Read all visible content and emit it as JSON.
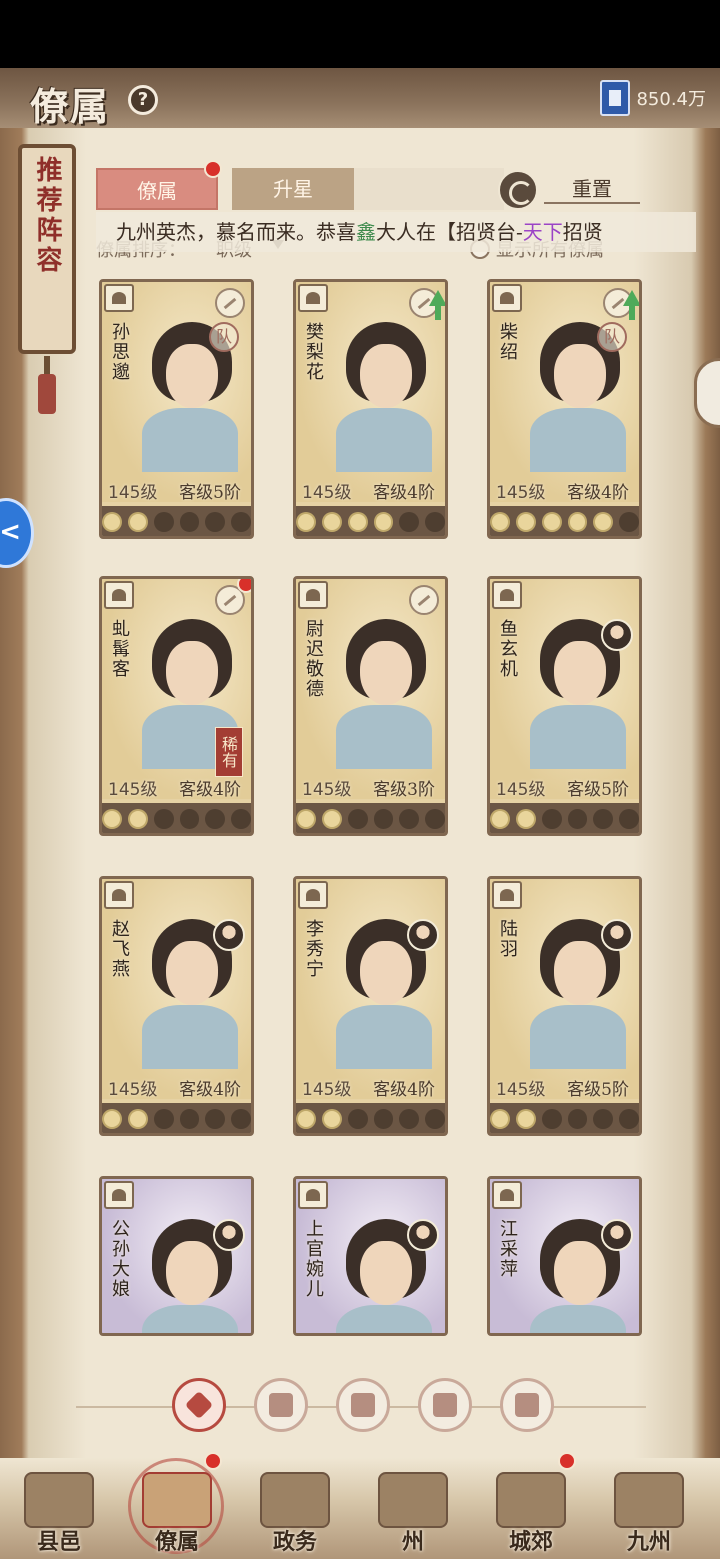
{
  "header": {
    "title": "僚属",
    "currency_value": "850.4万"
  },
  "ribbon": {
    "label": "推荐阵容"
  },
  "tabs": {
    "retainers": "僚属",
    "upgrade": "升星",
    "reset": "重置"
  },
  "marquee": {
    "prefix": "九州英杰，慕名而来。恭喜",
    "player": "鑫",
    "mid": "大人在【招贤台-",
    "pool": "天下",
    "suffix": "招贤"
  },
  "sort": {
    "label": "僚属排序：",
    "value": "职级",
    "show_all": "显示所有僚属"
  },
  "cards": [
    {
      "name": "孙思邈",
      "level": "145级",
      "rank": "客级5阶",
      "stars_on": 2,
      "badge": "队",
      "upgrade": false,
      "rare": "",
      "dot": false,
      "color": "gold"
    },
    {
      "name": "樊梨花",
      "level": "145级",
      "rank": "客级4阶",
      "stars_on": 4,
      "badge": "",
      "upgrade": true,
      "rare": "",
      "dot": false,
      "color": "gold"
    },
    {
      "name": "柴绍",
      "level": "145级",
      "rank": "客级4阶",
      "stars_on": 5,
      "badge": "队",
      "upgrade": true,
      "rare": "",
      "dot": false,
      "color": "gold"
    },
    {
      "name": "虬髯客",
      "level": "145级",
      "rank": "客级4阶",
      "stars_on": 2,
      "badge": "",
      "upgrade": false,
      "rare": "稀有",
      "dot": true,
      "color": "gold"
    },
    {
      "name": "尉迟敬德",
      "level": "145级",
      "rank": "客级3阶",
      "stars_on": 2,
      "badge": "",
      "upgrade": false,
      "rare": "",
      "dot": false,
      "color": "gold"
    },
    {
      "name": "鱼玄机",
      "level": "145级",
      "rank": "客级5阶",
      "stars_on": 2,
      "badge": "avatar",
      "upgrade": false,
      "rare": "",
      "dot": false,
      "color": "gold"
    },
    {
      "name": "赵飞燕",
      "level": "145级",
      "rank": "客级4阶",
      "stars_on": 2,
      "badge": "avatar",
      "upgrade": false,
      "rare": "",
      "dot": false,
      "color": "gold"
    },
    {
      "name": "李秀宁",
      "level": "145级",
      "rank": "客级4阶",
      "stars_on": 2,
      "badge": "avatar",
      "upgrade": false,
      "rare": "",
      "dot": false,
      "color": "gold"
    },
    {
      "name": "陆羽",
      "level": "145级",
      "rank": "客级5阶",
      "stars_on": 2,
      "badge": "avatar",
      "upgrade": false,
      "rare": "",
      "dot": false,
      "color": "gold"
    },
    {
      "name": "公孙大娘",
      "level": "",
      "rank": "",
      "stars_on": 0,
      "badge": "avatar",
      "upgrade": false,
      "rare": "",
      "dot": false,
      "color": "purple"
    },
    {
      "name": "上官婉儿",
      "level": "",
      "rank": "",
      "stars_on": 0,
      "badge": "avatar",
      "upgrade": false,
      "rare": "",
      "dot": false,
      "color": "purple"
    },
    {
      "name": "江采萍",
      "level": "",
      "rank": "",
      "stars_on": 0,
      "badge": "avatar",
      "upgrade": false,
      "rare": "",
      "dot": false,
      "color": "purple"
    }
  ],
  "filters": [
    "all-filter-icon",
    "hat-filter-icon",
    "beast-filter-icon",
    "fan-filter-icon",
    "lion-filter-icon"
  ],
  "nav": [
    {
      "label": "县邑",
      "icon": "county-gate-icon",
      "active": false,
      "dot": false
    },
    {
      "label": "僚属",
      "icon": "scroll-icon",
      "active": true,
      "dot": true
    },
    {
      "label": "政务",
      "icon": "documents-icon",
      "active": false,
      "dot": false
    },
    {
      "label": "州",
      "icon": "mountain-city-icon",
      "active": false,
      "dot": false
    },
    {
      "label": "城郊",
      "icon": "suburb-icon",
      "active": false,
      "dot": true
    },
    {
      "label": "九州",
      "icon": "map-icon",
      "active": false,
      "dot": false
    }
  ]
}
